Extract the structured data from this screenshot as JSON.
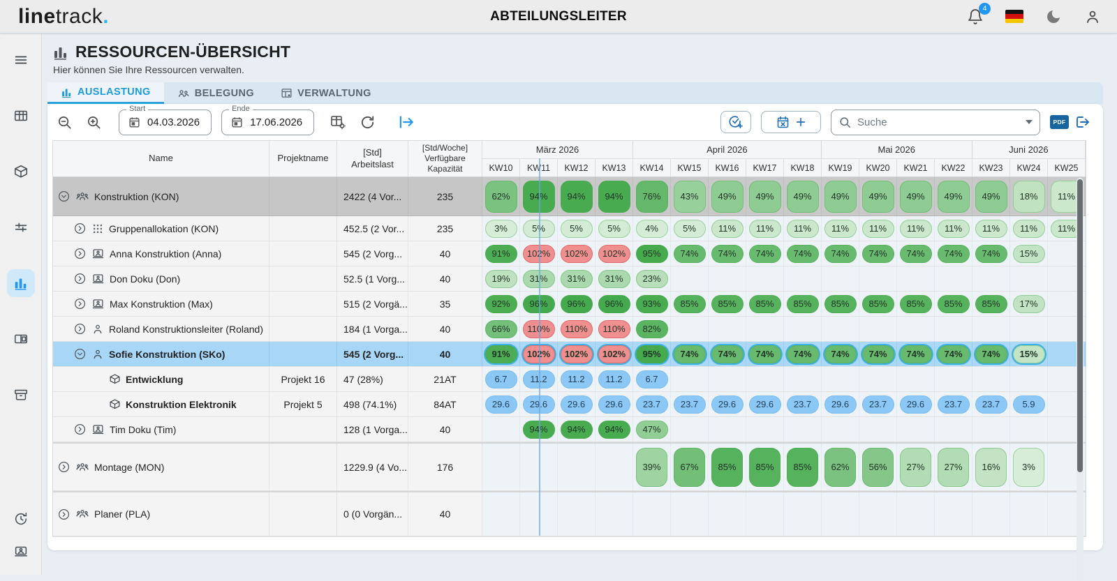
{
  "topbar": {
    "logo_bold": "line",
    "logo_light": "track",
    "logo_dot": ".",
    "title": "ABTEILUNGSLEITER",
    "notification_count": "4"
  },
  "sidebar": {
    "icons": [
      "menu-icon",
      "table-icon",
      "package-icon",
      "tune-icon",
      "bar-chart-icon",
      "columns-icon",
      "archive-icon",
      "history-icon",
      "workstation-icon"
    ]
  },
  "page": {
    "title": "RESSOURCEN-ÜBERSICHT",
    "subtitle": "Hier können Sie Ihre Ressourcen verwalten."
  },
  "tabs": [
    {
      "label": "AUSLASTUNG",
      "icon": "bar-chart-icon",
      "active": true
    },
    {
      "label": "BELEGUNG",
      "icon": "people-icon",
      "active": false
    },
    {
      "label": "VERWALTUNG",
      "icon": "table-icon",
      "active": false
    }
  ],
  "toolbar": {
    "start_label": "Start",
    "start_value": "04.03.2026",
    "end_label": "Ende",
    "end_value": "17.06.2026",
    "search_placeholder": "Suche",
    "pdf_label": "PDF"
  },
  "colors": {
    "green_low": "#dcefdc",
    "green_high": "#3fa747",
    "over_bg": "#ef8f8f",
    "over_border": "#e26a6a",
    "project_bg": "#8cc8f5",
    "project_border": "#7dbcee",
    "selected_row": "#a7d6f7",
    "today_line": "#6ea5dc",
    "accent": "#29b6f6"
  },
  "table": {
    "columns": {
      "name": "Name",
      "project": "Projektname",
      "workload1": "[Std]",
      "workload2": "Arbeitslast",
      "capacity1": "[Std/Woche]",
      "capacity2": "Verfügbare",
      "capacity3": "Kapazität"
    },
    "months": [
      {
        "label": "März 2026",
        "span": 4
      },
      {
        "label": "April 2026",
        "span": 5
      },
      {
        "label": "Mai 2026",
        "span": 4
      },
      {
        "label": "Juni 2026",
        "span": 3
      }
    ],
    "weeks": [
      "KW10",
      "KW11",
      "KW12",
      "KW13",
      "KW14",
      "KW15",
      "KW16",
      "KW17",
      "KW18",
      "KW19",
      "KW20",
      "KW21",
      "KW22",
      "KW23",
      "KW24",
      "KW25"
    ],
    "today_week_index": 1,
    "rows": [
      {
        "name": "Konstruktion (KON)",
        "icon": "team-icon",
        "expander": "expanded",
        "style": "group-dark",
        "indent": 0,
        "project": "",
        "workload": "2422 (4 Vor...",
        "capacity": "235",
        "kind": "pct",
        "cells": [
          62,
          94,
          94,
          94,
          76,
          43,
          49,
          49,
          49,
          49,
          49,
          49,
          49,
          49,
          18,
          11
        ]
      },
      {
        "name": "Gruppenallokation (KON)",
        "icon": "grid-allocation-icon",
        "expander": "collapsed",
        "style": "normal",
        "indent": 1,
        "project": "",
        "workload": "452.5 (2 Vor...",
        "capacity": "235",
        "kind": "pct",
        "cells": [
          3,
          5,
          5,
          5,
          4,
          5,
          11,
          11,
          11,
          11,
          11,
          11,
          11,
          11,
          11,
          11
        ]
      },
      {
        "name": "Anna Konstruktion (Anna)",
        "icon": "workstation-icon",
        "expander": "collapsed",
        "style": "normal",
        "indent": 1,
        "project": "",
        "workload": "545 (2 Vorg...",
        "capacity": "40",
        "kind": "pct",
        "cells": [
          91,
          102,
          102,
          102,
          95,
          74,
          74,
          74,
          74,
          74,
          74,
          74,
          74,
          74,
          15,
          null
        ]
      },
      {
        "name": "Don Doku (Don)",
        "icon": "workstation-icon",
        "expander": "collapsed",
        "style": "normal",
        "indent": 1,
        "project": "",
        "workload": "52.5 (1 Vorg...",
        "capacity": "40",
        "kind": "pct",
        "cells": [
          19,
          31,
          31,
          31,
          23,
          null,
          null,
          null,
          null,
          null,
          null,
          null,
          null,
          null,
          null,
          null
        ]
      },
      {
        "name": "Max Konstruktion (Max)",
        "icon": "workstation-icon",
        "expander": "collapsed",
        "style": "normal",
        "indent": 1,
        "project": "",
        "workload": "515 (2 Vorgä...",
        "capacity": "35",
        "kind": "pct",
        "cells": [
          92,
          96,
          96,
          96,
          93,
          85,
          85,
          85,
          85,
          85,
          85,
          85,
          85,
          85,
          17,
          null
        ]
      },
      {
        "name": "Roland Konstruktionsleiter (Roland)",
        "icon": "person-icon",
        "expander": "collapsed",
        "style": "normal",
        "indent": 1,
        "project": "",
        "workload": "184 (1 Vorga...",
        "capacity": "40",
        "kind": "pct",
        "cells": [
          66,
          110,
          110,
          110,
          82,
          null,
          null,
          null,
          null,
          null,
          null,
          null,
          null,
          null,
          null,
          null
        ]
      },
      {
        "name": "Sofie Konstruktion (SKo)",
        "icon": "person-icon",
        "expander": "expanded",
        "style": "selected",
        "indent": 1,
        "project": "",
        "workload": "545 (2 Vorg...",
        "capacity": "40",
        "kind": "pct",
        "cells": [
          91,
          102,
          102,
          102,
          95,
          74,
          74,
          74,
          74,
          74,
          74,
          74,
          74,
          74,
          15,
          null
        ]
      },
      {
        "name": "Entwicklung",
        "icon": "package-icon",
        "expander": "none",
        "style": "project",
        "indent": 2,
        "project": "Projekt 16",
        "workload": "47 (28%)",
        "capacity": "21AT",
        "kind": "num",
        "cells": [
          "6.7",
          "11.2",
          "11.2",
          "11.2",
          "6.7",
          null,
          null,
          null,
          null,
          null,
          null,
          null,
          null,
          null,
          null,
          null
        ]
      },
      {
        "name": "Konstruktion Elektronik",
        "icon": "package-icon",
        "expander": "none",
        "style": "project",
        "indent": 2,
        "project": "Projekt 5",
        "workload": "498 (74.1%)",
        "capacity": "84AT",
        "kind": "num",
        "cells": [
          "29.6",
          "29.6",
          "29.6",
          "29.6",
          "23.7",
          "23.7",
          "29.6",
          "29.6",
          "23.7",
          "29.6",
          "23.7",
          "29.6",
          "23.7",
          "23.7",
          "5.9",
          null
        ]
      },
      {
        "name": "Tim Doku (Tim)",
        "icon": "workstation-icon",
        "expander": "collapsed",
        "style": "normal",
        "indent": 1,
        "project": "",
        "workload": "128 (1 Vorga...",
        "capacity": "40",
        "kind": "pct",
        "cells": [
          null,
          94,
          94,
          94,
          47,
          null,
          null,
          null,
          null,
          null,
          null,
          null,
          null,
          null,
          null,
          null
        ]
      },
      {
        "name": "Montage (MON)",
        "icon": "team-icon",
        "expander": "collapsed",
        "style": "group-tall",
        "indent": 0,
        "project": "",
        "workload": "1229.9 (4 Vo...",
        "capacity": "176",
        "kind": "pct",
        "cells": [
          null,
          null,
          null,
          null,
          39,
          67,
          85,
          85,
          85,
          62,
          56,
          27,
          27,
          16,
          3,
          null
        ]
      },
      {
        "name": "Planer (PLA)",
        "icon": "team-icon",
        "expander": "collapsed",
        "style": "group-tall2",
        "indent": 0,
        "project": "",
        "workload": "0 (0 Vorgän...",
        "capacity": "40",
        "kind": "pct",
        "cells": [
          null,
          null,
          null,
          null,
          null,
          null,
          null,
          null,
          null,
          null,
          null,
          null,
          null,
          null,
          null,
          null
        ]
      }
    ]
  }
}
